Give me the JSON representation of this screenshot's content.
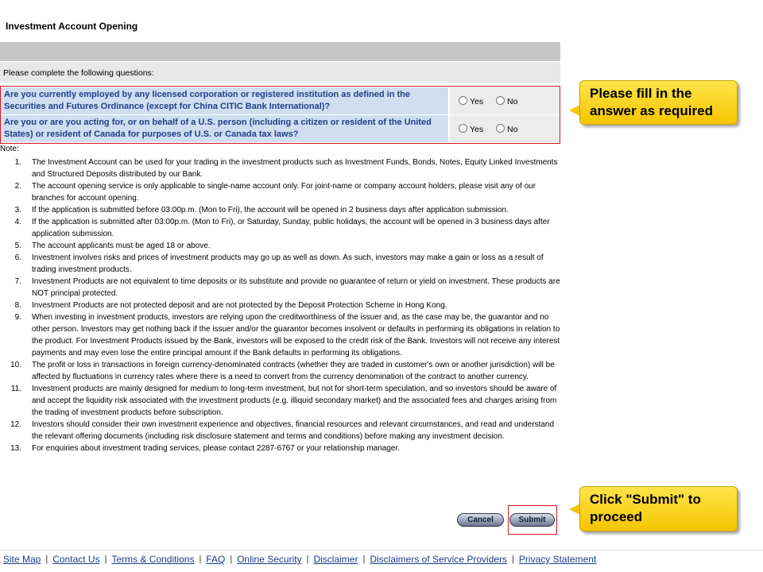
{
  "page": {
    "title": "Investment Account Opening"
  },
  "instructions": "Please complete the following questions:",
  "questions": [
    {
      "text": "Are you currently employed by any licensed corporation or registered institution as defined in the Securities and Futures Ordinance (except for China CITIC Bank International)?",
      "yes_label": "Yes",
      "no_label": "No"
    },
    {
      "text": "Are you or are you acting for, or on behalf of a U.S. person (including a citizen or resident of the United States) or resident of Canada for purposes of U.S. or Canada tax laws?",
      "yes_label": "Yes",
      "no_label": "No"
    }
  ],
  "note_label": "Note:",
  "notes": [
    {
      "num": "1.",
      "text": "The Investment Account can be used for your trading in the investment products such as Investment Funds, Bonds, Notes, Equity Linked Investments and Structured Deposits distributed by our Bank."
    },
    {
      "num": "2.",
      "text": "The account opening service is only applicable to single-name account only. For joint-name or company account holders, please visit any of our branches for account opening."
    },
    {
      "num": "3.",
      "text": "If the application is submitted before 03:00p.m. (Mon to Fri), the account will be opened in 2 business days after application submission."
    },
    {
      "num": "4.",
      "text": "If the application is submitted after 03:00p.m. (Mon to Fri), or Saturday, Sunday, public holidays, the account will be opened in 3 business days after application submission."
    },
    {
      "num": "5.",
      "text": "The account applicants must be aged 18 or above."
    },
    {
      "num": "6.",
      "text": "Investment involves risks and prices of investment products may go up as well as down. As such, investors may make a gain or loss as a result of trading investment products."
    },
    {
      "num": "7.",
      "text": "Investment Products are not equivalent to time deposits or its substitute and provide no guarantee of return or yield on investment. These products are NOT principal protected."
    },
    {
      "num": "8.",
      "text": "Investment Products are not protected deposit and are not protected by the Deposit Protection Scheme in Hong Kong."
    },
    {
      "num": "9.",
      "text": "When investing in investment products, investors are relying upon the creditworthiness of the issuer and, as the case may be, the guarantor and no other person. Investors may get nothing back if the issuer and/or the guarantor becomes insolvent or defaults in performing its obligations in relation to the product. For Investment Products issued by the Bank, investors will be exposed to the credit risk of the Bank. Investors will not receive any interest payments and may even lose the entire principal amount if the Bank defaults in performing its obligations."
    },
    {
      "num": "10.",
      "text": "The profit or loss in transactions in foreign currency-denominated contracts (whether they are traded in customer's own or another jurisdiction) will be affected by fluctuations in currency rates where there is a need to convert from the currency denomination of the contract to another currency."
    },
    {
      "num": "11.",
      "text": "Investment products are mainly designed for medium to long-term investment, but not for short-term speculation, and so investors should be aware of and accept the liquidity risk associated with the investment products (e.g. illiquid secondary market) and the associated fees and charges arising from the trading of investment products before subscription."
    },
    {
      "num": "12.",
      "text": "Investors should consider their own investment experience and objectives, financial resources and relevant circumstances, and read and understand the relevant offering documents (including risk disclosure statement and terms and conditions) before making any investment decision."
    },
    {
      "num": "13.",
      "text": "For enquiries about investment trading services, please contact 2287-6767 or your relationship manager."
    }
  ],
  "buttons": {
    "cancel": "Cancel",
    "submit": "Submit"
  },
  "callouts": {
    "fill": "Please fill in the answer as required",
    "submit": "Click \"Submit\" to proceed"
  },
  "footer": {
    "separator": "|",
    "links": [
      "Site Map",
      "Contact Us",
      "Terms & Conditions",
      "FAQ",
      "Online Security",
      "Disclaimer",
      "Disclaimers of Service Providers",
      "Privacy Statement"
    ]
  },
  "colors": {
    "question_text": "#1f3f86",
    "question_bg": "#cfdff1",
    "highlight_border": "#d21b1b",
    "callout": "#f4c500",
    "link": "#1a3d8c"
  }
}
